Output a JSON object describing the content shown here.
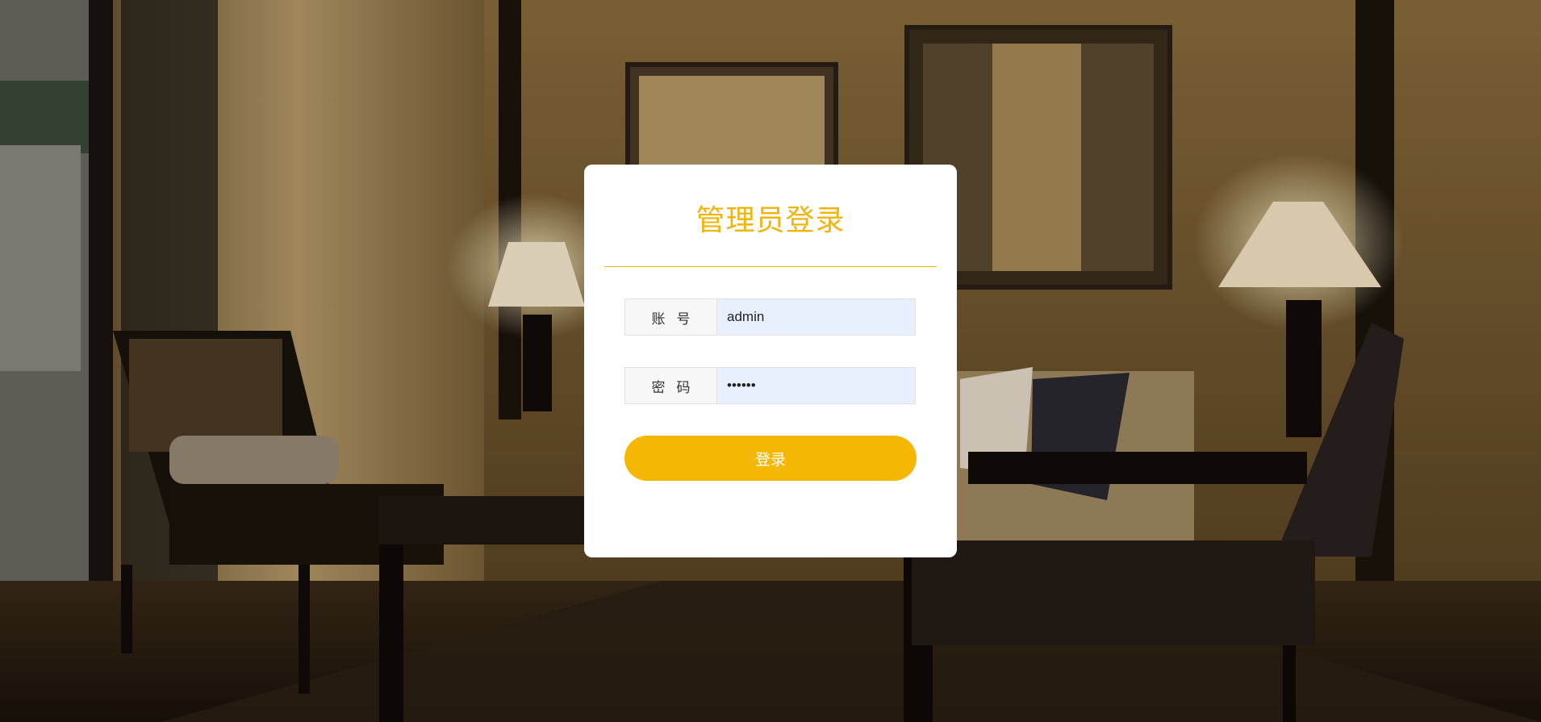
{
  "login": {
    "title": "管理员登录",
    "username_label": "账号",
    "username_value": "admin",
    "password_label": "密码",
    "password_value": "123456",
    "submit_label": "登录"
  },
  "colors": {
    "accent": "#f5b704",
    "title": "#f0b40a",
    "input_background": "#e8f0fe",
    "card_background": "#ffffff"
  }
}
